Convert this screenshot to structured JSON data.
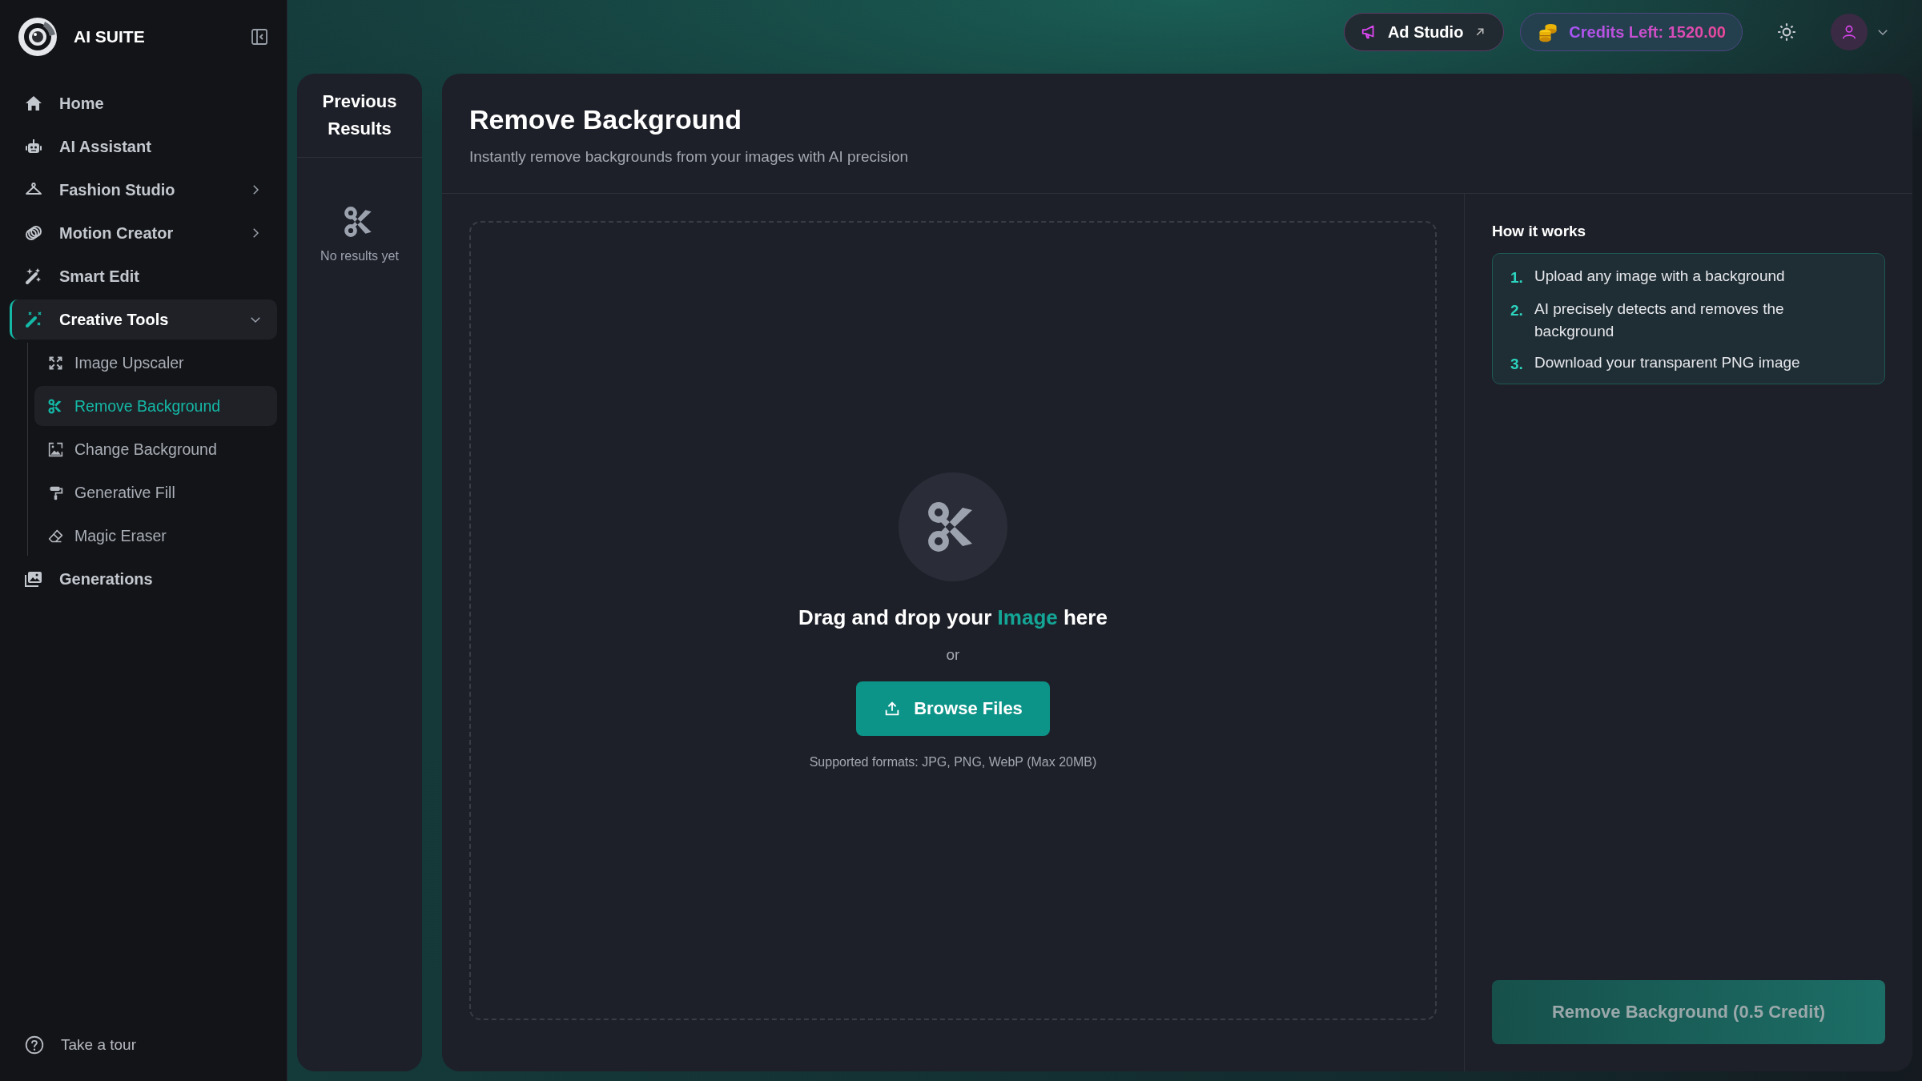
{
  "sidebar": {
    "brand": "AI SUITE",
    "nav": [
      {
        "label": "Home",
        "kind": "link",
        "selected": false
      },
      {
        "label": "AI Assistant",
        "kind": "link",
        "selected": false
      },
      {
        "label": "Fashion Studio",
        "kind": "group",
        "expanded": false,
        "selected": false
      },
      {
        "label": "Motion Creator",
        "kind": "group",
        "expanded": false,
        "selected": false
      },
      {
        "label": "Smart Edit",
        "kind": "link",
        "selected": false
      },
      {
        "label": "Creative Tools",
        "kind": "group",
        "expanded": true,
        "selected": true,
        "children": [
          {
            "label": "Image Upscaler",
            "selected": false
          },
          {
            "label": "Remove Background",
            "selected": true
          },
          {
            "label": "Change Background",
            "selected": false
          },
          {
            "label": "Generative Fill",
            "selected": false
          },
          {
            "label": "Magic Eraser",
            "selected": false
          }
        ]
      },
      {
        "label": "Generations",
        "kind": "link",
        "selected": false
      }
    ],
    "footer": "Take a tour"
  },
  "topbar": {
    "ad_studio": "Ad Studio",
    "credits": "Credits Left: 1520.00"
  },
  "previous_results": {
    "title": "Previous Results",
    "empty": "No results yet"
  },
  "tool": {
    "title": "Remove Background",
    "subtitle": "Instantly remove backgrounds from your images with AI precision",
    "dropzone": {
      "prompt_before": "Drag and drop your",
      "prompt_highlight": "Image",
      "prompt_after": "here",
      "or": "or",
      "button": "Browse Files",
      "formats": "Supported formats: JPG, PNG, WebP (Max 20MB)"
    },
    "how_it_works": {
      "title": "How it works",
      "steps": [
        {
          "number": "1.",
          "text": "Upload any image with a background"
        },
        {
          "number": "2.",
          "text": "AI precisely detects and removes the background"
        },
        {
          "number": "3.",
          "text": "Download your transparent PNG image"
        }
      ]
    },
    "action": {
      "label": "Remove Background (0.5 Credit)",
      "disabled": true
    }
  }
}
